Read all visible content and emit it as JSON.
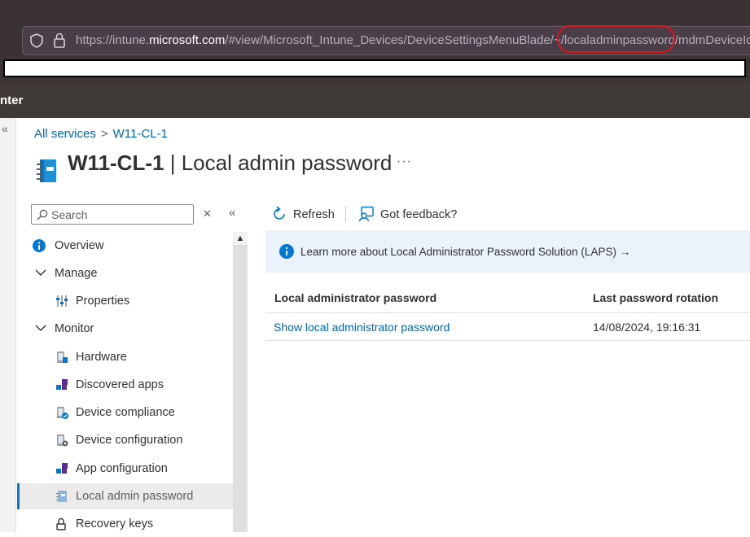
{
  "browser": {
    "url_prefix": "https://intune.",
    "url_host": "microsoft.com",
    "url_suffix": "/#view/Microsoft_Intune_Devices/DeviceSettingsMenuBlade/~/localadminpassword/mdmDeviceId"
  },
  "portal": {
    "header_title": "nter"
  },
  "rail": {
    "expand_label": "«"
  },
  "breadcrumb": {
    "items": [
      "All services",
      "W11-CL-1"
    ],
    "separator": ">"
  },
  "page": {
    "device_name": "W11-CL-1",
    "separator": "|",
    "blade_title": "Local admin password",
    "more_label": "···"
  },
  "sidebar": {
    "search_placeholder": "Search",
    "clear_label": "✕",
    "collapse_label": "«",
    "items": [
      {
        "label": "Overview",
        "icon": "info-icon"
      },
      {
        "label": "Manage",
        "icon": "chevron-down-icon"
      },
      {
        "label": "Properties",
        "icon": "properties-icon"
      },
      {
        "label": "Monitor",
        "icon": "chevron-down-icon"
      },
      {
        "label": "Hardware",
        "icon": "hardware-icon"
      },
      {
        "label": "Discovered apps",
        "icon": "apps-icon"
      },
      {
        "label": "Device compliance",
        "icon": "compliance-icon"
      },
      {
        "label": "Device configuration",
        "icon": "configuration-icon"
      },
      {
        "label": "App configuration",
        "icon": "apps-icon"
      },
      {
        "label": "Local admin password",
        "icon": "notebook-icon",
        "active": true
      },
      {
        "label": "Recovery keys",
        "icon": "key-icon"
      }
    ]
  },
  "toolbar": {
    "refresh_label": "Refresh",
    "feedback_label": "Got feedback?"
  },
  "info": {
    "text": "Learn more about Local Administrator Password Solution (LAPS)",
    "arrow": "→"
  },
  "table": {
    "columns": [
      "Local administrator password",
      "Last password rotation"
    ],
    "rows": [
      {
        "password_link": "Show local administrator password",
        "rotation": "14/08/2024, 19:16:31"
      }
    ]
  },
  "colors": {
    "accent": "#0078d4",
    "link": "#0067b8",
    "highlight": "#e0141e",
    "info_bg": "#eaf3fc"
  }
}
